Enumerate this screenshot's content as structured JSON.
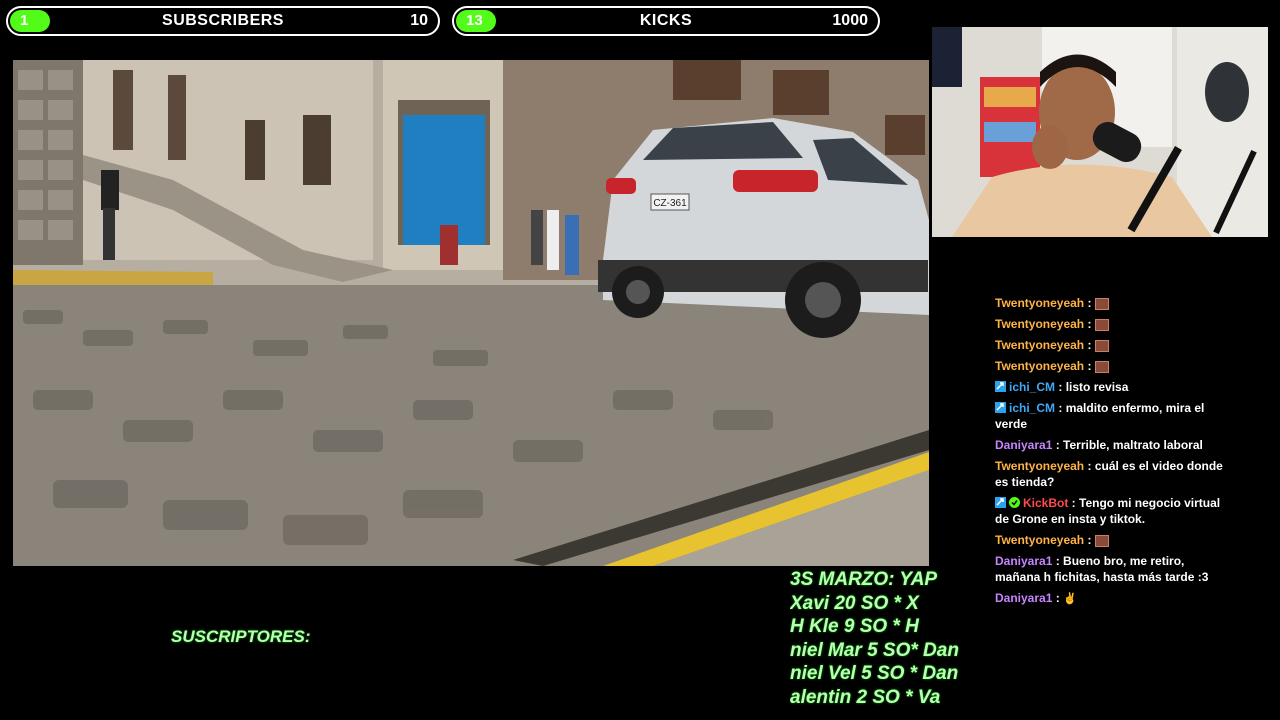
{
  "goals": [
    {
      "count": "1",
      "title": "SUBSCRIBERS",
      "target": "10"
    },
    {
      "count": "13",
      "title": "KICKS",
      "target": "1000"
    }
  ],
  "colors": {
    "accent": "#53fc18",
    "ticker_text": "#b8ffb2"
  },
  "video": {
    "plate": "CZ-361"
  },
  "chat": [
    {
      "user": "Twentyoneyeah",
      "color": "#ffb347",
      "text": "",
      "emote": "emote-icon"
    },
    {
      "user": "Twentyoneyeah",
      "color": "#ffb347",
      "text": "",
      "emote": "emote-icon"
    },
    {
      "user": "Twentyoneyeah",
      "color": "#ffb347",
      "text": "",
      "emote": "emote-icon"
    },
    {
      "user": "Twentyoneyeah",
      "color": "#ffb347",
      "text": "",
      "emote": "emote-icon"
    },
    {
      "user": "ichi_CM",
      "color": "#3fa9f5",
      "text": "listo revisa",
      "badge": "moderator-icon"
    },
    {
      "user": "ichi_CM",
      "color": "#3fa9f5",
      "text": "maldito enfermo, mira el verde",
      "badge": "moderator-icon"
    },
    {
      "user": "Daniyara1",
      "color": "#c784ff",
      "text": "Terrible, maltrato laboral"
    },
    {
      "user": "Twentyoneyeah",
      "color": "#ffb347",
      "text": "cuál es el video donde es tienda?"
    },
    {
      "user": "KickBot",
      "color": "#ff4b4b",
      "text": "Tengo mi negocio virtual de Grone en insta y tiktok.",
      "badge": "moderator-icon",
      "badge2": "verified-icon"
    },
    {
      "user": "Twentyoneyeah",
      "color": "#ffb347",
      "text": "",
      "emote": "emote-icon"
    },
    {
      "user": "Daniyara1",
      "color": "#c784ff",
      "text": "Bueno bro, me retiro, mañana h fichitas, hasta más tarde :3"
    },
    {
      "user": "Daniyara1",
      "color": "#c784ff",
      "text": "",
      "emote": "hand-emoji-icon"
    }
  ],
  "bottom": {
    "subs_label": "SUSCRIPTORES:",
    "ticker_lines": [
      "3S MARZO:   YAP",
      "Xavi 20 SO          * X",
      "H Kle 9 SO         * H",
      "niel Mar 5 SO* Dan",
      "niel Vel 5 SO  * Dan",
      "alentin 2 SO      * Va"
    ]
  }
}
